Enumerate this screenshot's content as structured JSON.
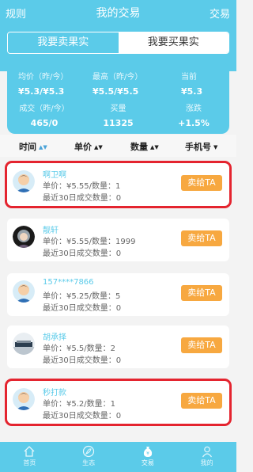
{
  "header": {
    "left": "规则",
    "title": "我的交易",
    "right": "交易"
  },
  "segment": {
    "active": "我要卖果实",
    "inactive": "我要买果实"
  },
  "stats": {
    "avg_label": "均价（昨/今）",
    "avg_value": "¥5.3/¥5.3",
    "high_label": "最高（昨/今）",
    "high_value": "¥5.5/¥5.5",
    "cur_label": "当前",
    "cur_value": "¥5.3",
    "deal_label": "成交（昨/今）",
    "deal_value": "465/0",
    "buy_label": "买量",
    "buy_value": "11325",
    "chg_label": "涨跌",
    "chg_value": "+1.5%"
  },
  "sort": {
    "time": "时间",
    "price": "单价",
    "qty": "数量",
    "phone": "手机号"
  },
  "cards": [
    {
      "name": "啊卫啊",
      "line1": "单价：¥5.55/数量：1",
      "line2": "最近30日成交数量：0",
      "button": "卖给TA"
    },
    {
      "name": "靓轩",
      "line1": "单价：¥5.55/数量：1999",
      "line2": "最近30日成交数量：0",
      "button": "卖给TA"
    },
    {
      "name": "157****7866",
      "line1": "单价：¥5.25/数量：5",
      "line2": "最近30日成交数量：0",
      "button": "卖给TA"
    },
    {
      "name": "胡承择",
      "line1": "单价：¥5.5/数量：2",
      "line2": "最近30日成交数量：0",
      "button": "卖给TA"
    },
    {
      "name": "秒打款",
      "line1": "单价：¥5.2/数量：1",
      "line2": "最近30日成交数量：0",
      "button": "卖给TA"
    }
  ],
  "tabs": [
    "首页",
    "生态",
    "交易",
    "我的"
  ],
  "colors": {
    "primary": "#5bcbe9",
    "button": "#f7a840",
    "highlight": "#e4242f"
  }
}
